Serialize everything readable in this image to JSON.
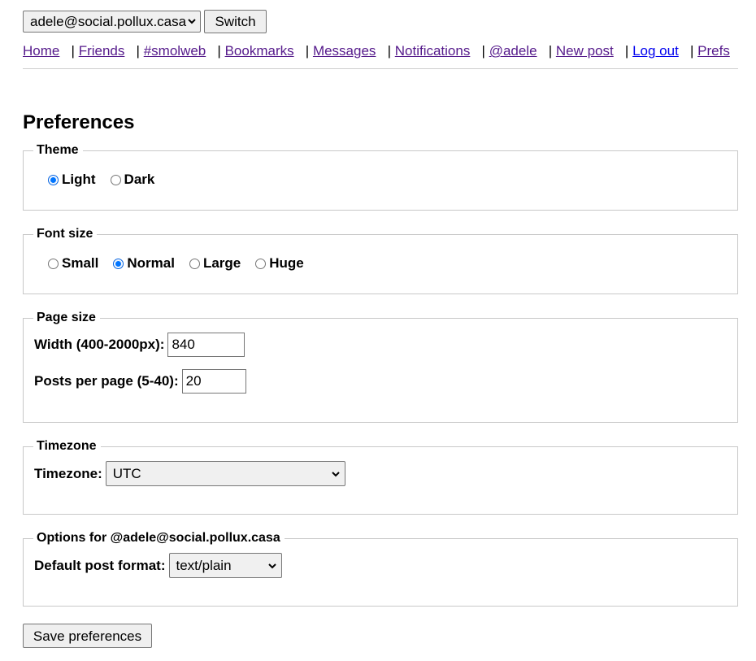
{
  "account": {
    "selected": "adele@social.pollux.casa",
    "switch_label": "Switch"
  },
  "nav": {
    "items": [
      {
        "label": "Home"
      },
      {
        "label": "Friends"
      },
      {
        "label": "#smolweb"
      },
      {
        "label": "Bookmarks"
      },
      {
        "label": "Messages"
      },
      {
        "label": "Notifications"
      },
      {
        "label": "@adele"
      },
      {
        "label": "New post"
      },
      {
        "label": "Log out"
      },
      {
        "label": "Prefs"
      }
    ],
    "separator": "|"
  },
  "page_title": "Preferences",
  "theme": {
    "legend": "Theme",
    "options": [
      "Light",
      "Dark"
    ],
    "selected": "Light"
  },
  "font_size": {
    "legend": "Font size",
    "options": [
      "Small",
      "Normal",
      "Large",
      "Huge"
    ],
    "selected": "Normal"
  },
  "page_size": {
    "legend": "Page size",
    "width_label": "Width (400-2000px):",
    "width_value": "840",
    "posts_label": "Posts per page (5-40):",
    "posts_value": "20"
  },
  "timezone": {
    "legend": "Timezone",
    "label": "Timezone:",
    "selected": "UTC"
  },
  "options": {
    "legend": "Options for @adele@social.pollux.casa",
    "label": "Default post format:",
    "selected": "text/plain"
  },
  "save_label": "Save preferences",
  "colors": {
    "link_visited": "#551a8b",
    "link_unvisited": "#0000ee",
    "radio_accent": "#0075ff"
  }
}
